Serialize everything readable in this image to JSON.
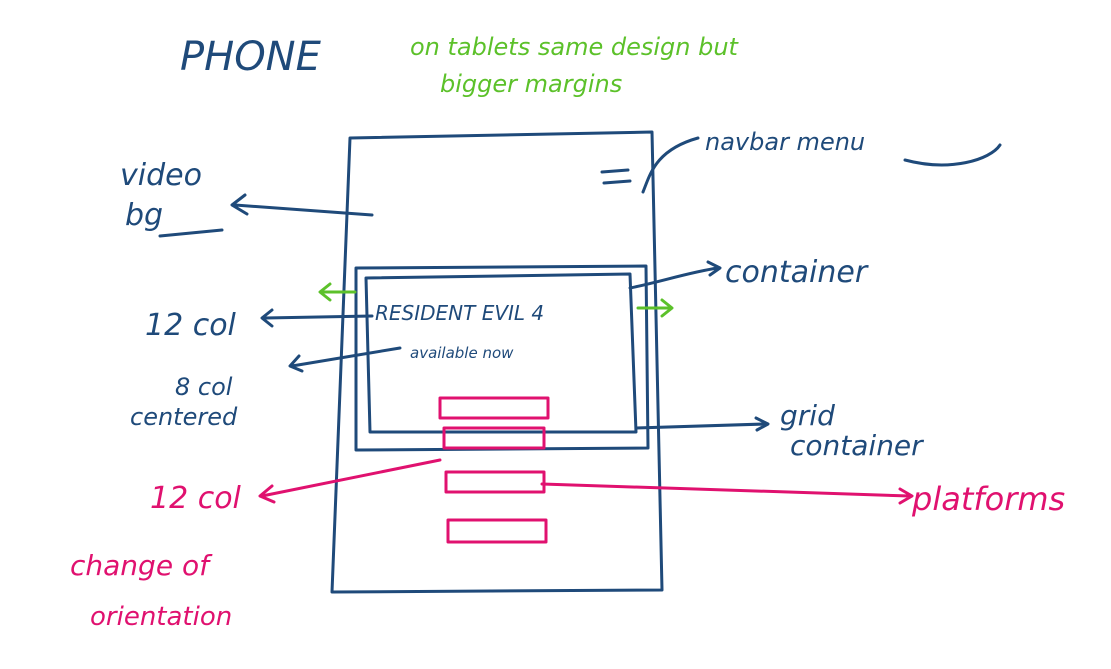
{
  "colors": {
    "structure": "#1f4a7a",
    "note": "#5cc12a",
    "platforms": "#e0116f",
    "background": "#ffffff"
  },
  "title": "PHONE",
  "note_line1": "on tablets same design but",
  "note_line2": "bigger margins",
  "label_navbar": "navbar menu",
  "label_video_line1": "video",
  "label_video_line2": "bg",
  "label_container": "container",
  "label_12col": "12 col",
  "label_8col_line1": "8 col",
  "label_8col_line2": "centered",
  "label_grid_line1": "grid",
  "label_grid_line2": "container",
  "label_pink12_line1": "12 col",
  "label_pink12_line2": "change of",
  "label_pink12_line3": "orientation",
  "label_platforms": "platforms",
  "content_title": "RESIDENT EVIL 4",
  "content_subtitle": "available now",
  "icons": {
    "hamburger": "hamburger-menu-icon"
  }
}
